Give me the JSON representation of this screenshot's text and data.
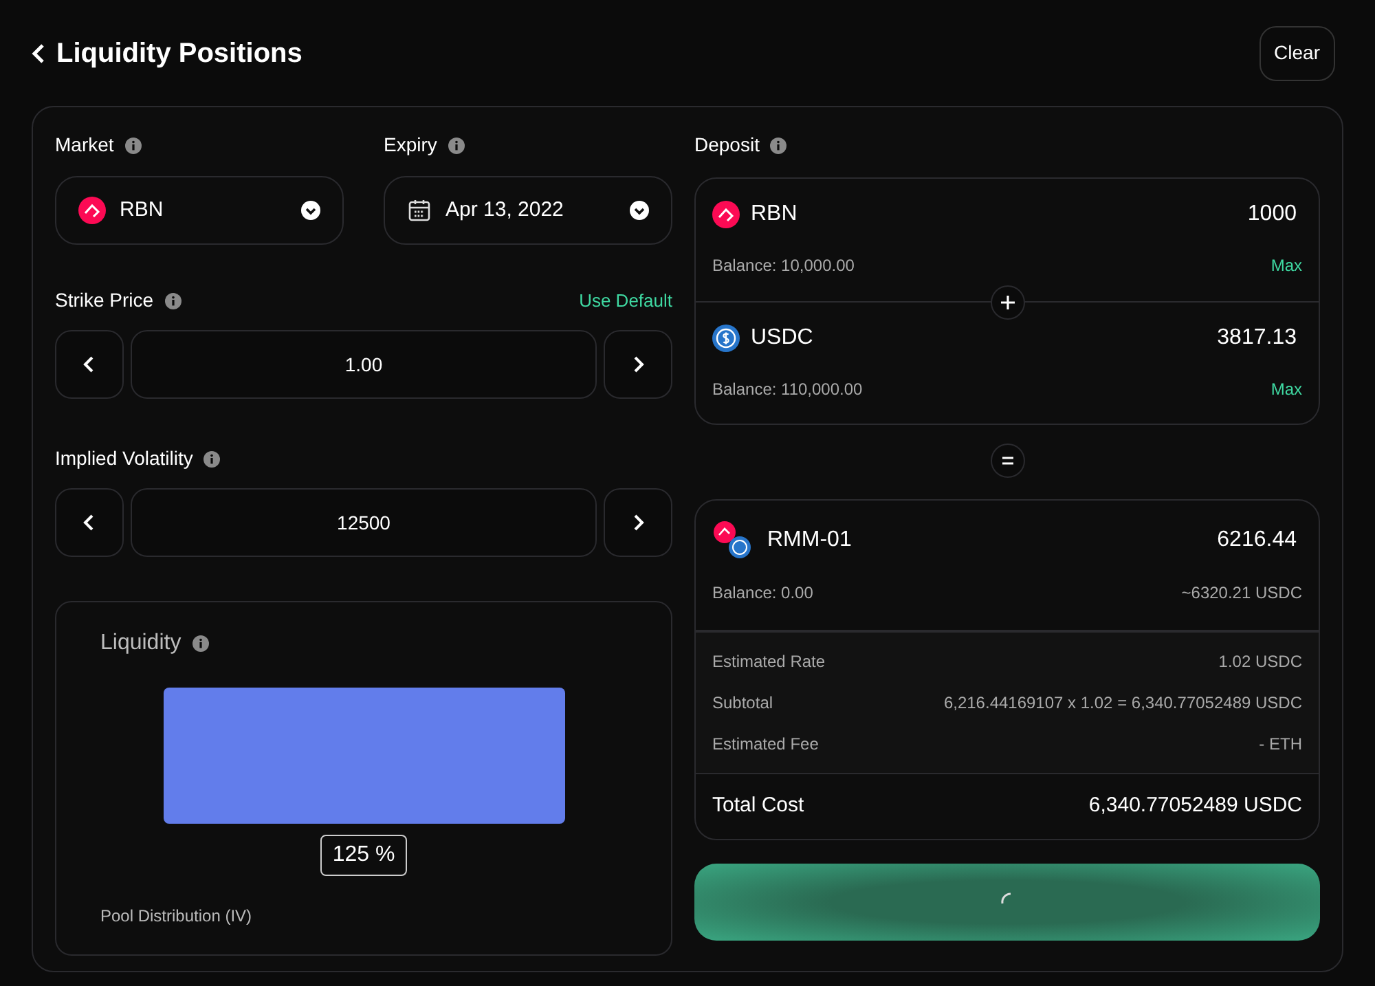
{
  "header": {
    "title": "Liquidity Positions",
    "clear_button": "Clear"
  },
  "market": {
    "label": "Market",
    "token": "RBN"
  },
  "expiry": {
    "label": "Expiry",
    "value": "Apr 13, 2022"
  },
  "strike": {
    "label": "Strike Price",
    "link": "Use Default",
    "value": "1.00"
  },
  "volatility": {
    "label": "Implied Volatility",
    "value": "12500"
  },
  "liquidity": {
    "title": "Liquidity",
    "badge": "125 %",
    "caption": "Pool Distribution (IV)"
  },
  "deposit": {
    "label": "Deposit",
    "assets": [
      {
        "token": "RBN",
        "amount": "1000",
        "balance": "Balance: 10,000.00",
        "max": "Max"
      },
      {
        "token": "USDC",
        "amount": "3817.13",
        "balance": "Balance: 110,000.00",
        "max": "Max"
      }
    ]
  },
  "position": {
    "token": "RMM-01",
    "amount": "6216.44",
    "balance": "Balance: 0.00",
    "value": "~6320.21 USDC"
  },
  "details": [
    {
      "label": "Estimated Rate",
      "value": "1.02 USDC"
    },
    {
      "label": "Subtotal",
      "value": "6,216.44169107 x 1.02 = 6,340.77052489 USDC"
    },
    {
      "label": "Estimated Fee",
      "value": "- ETH"
    }
  ],
  "total": {
    "label": "Total Cost",
    "value": "6,340.77052489 USDC"
  }
}
